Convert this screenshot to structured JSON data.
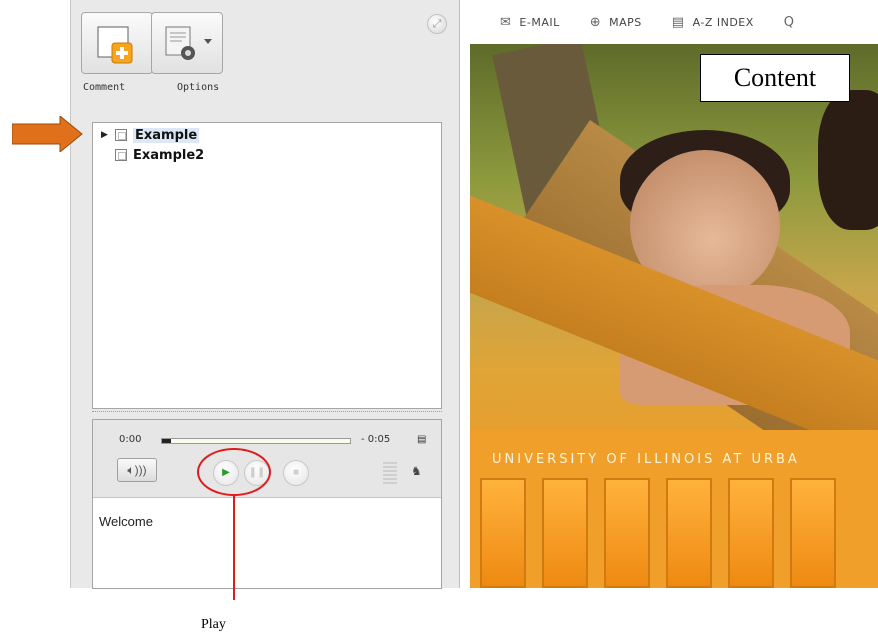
{
  "toolbar": {
    "comment_label": "Comment",
    "options_label": "Options",
    "pin_icon": "pin-icon"
  },
  "tree": {
    "items": [
      {
        "label": "Example",
        "selected": true,
        "expandable": true
      },
      {
        "label": "Example2",
        "selected": false,
        "expandable": false
      }
    ]
  },
  "player": {
    "time_elapsed": "0:00",
    "time_remaining": "- 0:05",
    "progress_fraction": 0.05
  },
  "notes": {
    "text": "Welcome"
  },
  "content_nav": {
    "items": [
      {
        "label": "E-MAIL",
        "icon": "envelope-icon",
        "glyph": "✉"
      },
      {
        "label": "MAPS",
        "icon": "compass-icon",
        "glyph": "⊕"
      },
      {
        "label": "A-Z INDEX",
        "icon": "document-icon",
        "glyph": "▤"
      },
      {
        "label": "",
        "icon": "search-icon",
        "glyph": "Q"
      }
    ]
  },
  "content_banner": {
    "university_text": "UNIVERSITY OF ILLINOIS AT URBA"
  },
  "annotations": {
    "content_label": "Content",
    "play_label": "Play",
    "arrow_color": "#e0711a",
    "circle_color": "#e01b1b"
  }
}
